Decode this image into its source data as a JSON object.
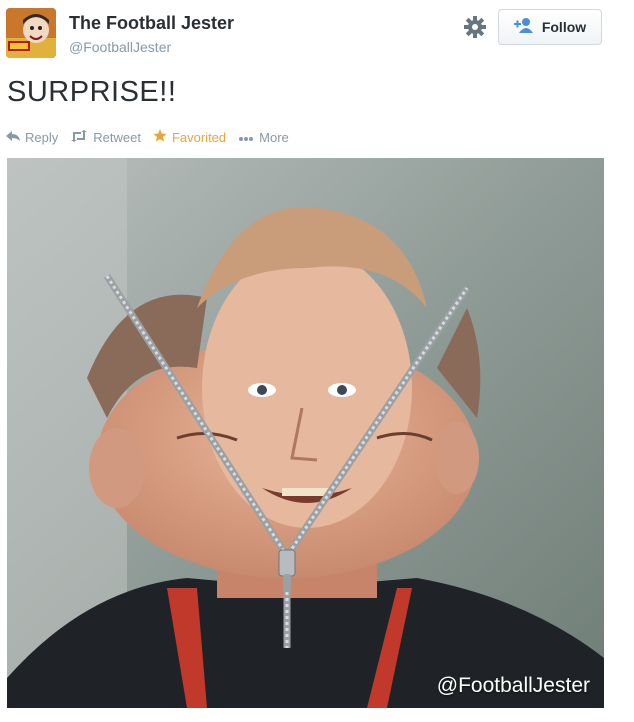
{
  "account": {
    "name": "The Football Jester",
    "handle": "@FootballJester"
  },
  "follow_button": {
    "label": "Follow"
  },
  "tweet": {
    "text": "SURPRISE!!"
  },
  "actions": {
    "reply": "Reply",
    "retweet": "Retweet",
    "favorited": "Favorited",
    "more": "More"
  },
  "photo": {
    "watermark": "@FootballJester"
  },
  "colors": {
    "muted": "#8899a6",
    "favorite": "#e8a33a",
    "follow_icon": "#4a90d9"
  },
  "icons": [
    "avatar-illustration",
    "gear-icon",
    "add-user-icon",
    "reply-icon",
    "retweet-icon",
    "star-icon",
    "ellipsis-icon"
  ]
}
